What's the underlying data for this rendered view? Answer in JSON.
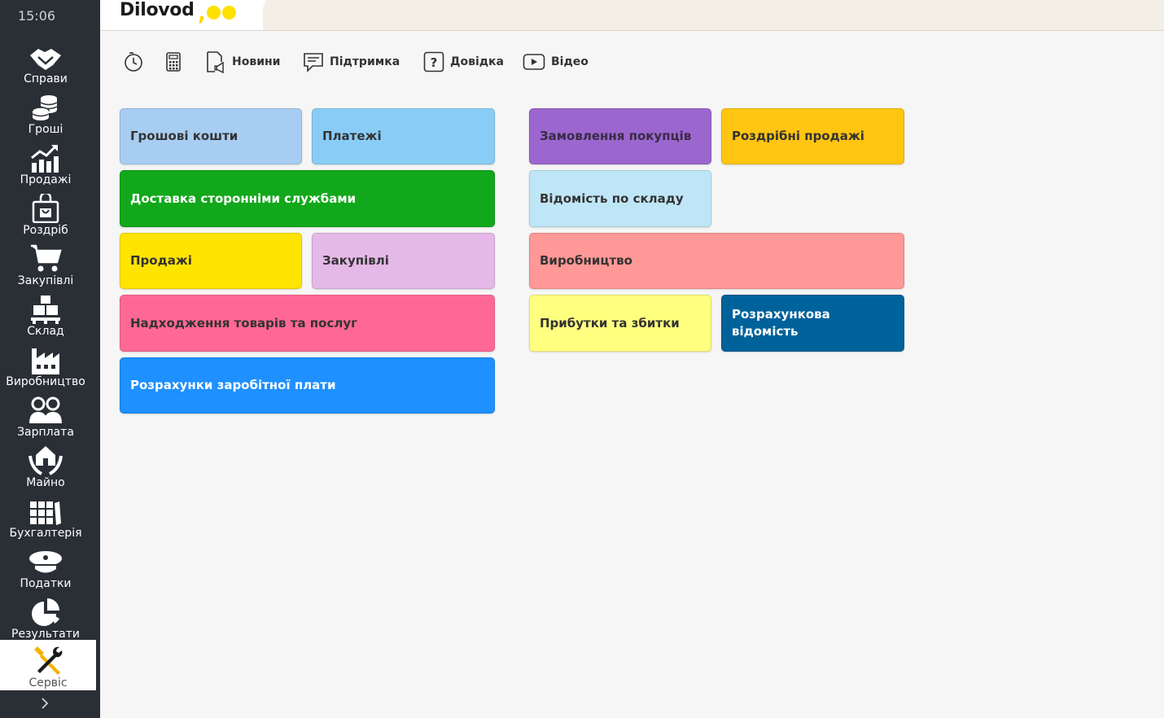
{
  "clock": "15:06",
  "sidebar": {
    "items": [
      {
        "label": "Справи",
        "icon": "handshake-icon"
      },
      {
        "label": "Гроші",
        "icon": "coins-icon"
      },
      {
        "label": "Продажі",
        "icon": "growth-chart-icon"
      },
      {
        "label": "Роздріб",
        "icon": "shopping-bag-icon"
      },
      {
        "label": "Закупівлі",
        "icon": "shopping-cart-icon"
      },
      {
        "label": "Склад",
        "icon": "warehouse-boxes-icon"
      },
      {
        "label": "Виробництво",
        "icon": "factory-icon"
      },
      {
        "label": "Зарплата",
        "icon": "people-icon"
      },
      {
        "label": "Майно",
        "icon": "house-hands-icon"
      },
      {
        "label": "Бухгалтерія",
        "icon": "books-icon"
      },
      {
        "label": "Податки",
        "icon": "officer-cap-icon"
      },
      {
        "label": "Результати",
        "icon": "pie-chart-icon"
      },
      {
        "label": "Сервіс",
        "icon": "tools-icon",
        "active": true
      }
    ],
    "expand_icon": "chevron-right-icon"
  },
  "header": {
    "logo_text": "Dilovod",
    "logo_comma": ","
  },
  "toolbar": {
    "history_icon": "clock-history-icon",
    "calculator_icon": "calculator-icon",
    "news_label": "Новини",
    "support_label": "Підтримка",
    "help_label": "Довідка",
    "video_label": "Відео"
  },
  "tiles": {
    "cash": {
      "label": "Грошові кошти",
      "color": "#a8cdf2"
    },
    "payments": {
      "label": "Платежі",
      "color": "#89cdf6"
    },
    "delivery": {
      "label": "Доставка сторонніми службами",
      "color": "#12a81b"
    },
    "sales": {
      "label": "Продажі",
      "color": "#ffe400"
    },
    "purchases": {
      "label": "Закупівлі",
      "color": "#e5b9e7"
    },
    "receipts": {
      "label": "Надходження товарів та послуг",
      "color": "#ff6896"
    },
    "payroll": {
      "label": "Розрахунки заробітної плати",
      "color": "#1e90ff"
    },
    "customer_orders": {
      "label": "Замовлення покупців",
      "color": "#9b67cf"
    },
    "retail_sales": {
      "label": "Роздрібні продажі",
      "color": "#ffc510"
    },
    "stock_report": {
      "label": "Відомість по складу",
      "color": "#bfe6f7"
    },
    "production": {
      "label": "Виробництво",
      "color": "#ff9896"
    },
    "profit_loss": {
      "label": "Прибутки та збитки",
      "color": "#ffff80"
    },
    "pay_sheet": {
      "label": "Розрахункова відомість",
      "color": "#00629a"
    }
  }
}
